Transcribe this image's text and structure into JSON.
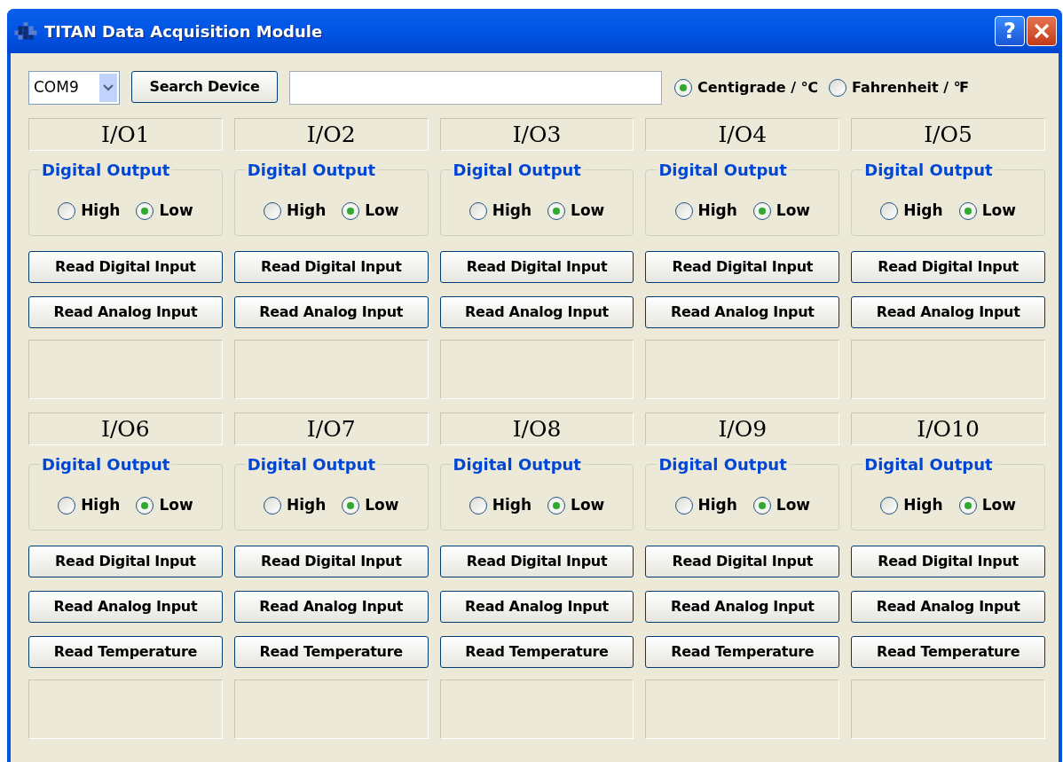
{
  "window": {
    "title": "TITAN Data Acquisition Module",
    "help_button": "?"
  },
  "toolbar": {
    "port": "COM9",
    "search_button": "Search Device",
    "units": [
      {
        "label": "Centigrade / ℃",
        "selected": true
      },
      {
        "label": "Fahrenheit / ℉",
        "selected": false
      }
    ]
  },
  "sections": [
    {
      "channels": [
        {
          "name": "I/O1",
          "group_title": "Digital Output",
          "options": [
            {
              "label": "High",
              "selected": false
            },
            {
              "label": "Low",
              "selected": true
            }
          ],
          "buttons": [
            "Read Digital Input",
            "Read Analog Input"
          ]
        },
        {
          "name": "I/O2",
          "group_title": "Digital Output",
          "options": [
            {
              "label": "High",
              "selected": false
            },
            {
              "label": "Low",
              "selected": true
            }
          ],
          "buttons": [
            "Read Digital Input",
            "Read Analog Input"
          ]
        },
        {
          "name": "I/O3",
          "group_title": "Digital Output",
          "options": [
            {
              "label": "High",
              "selected": false
            },
            {
              "label": "Low",
              "selected": true
            }
          ],
          "buttons": [
            "Read Digital Input",
            "Read Analog Input"
          ]
        },
        {
          "name": "I/O4",
          "group_title": "Digital Output",
          "options": [
            {
              "label": "High",
              "selected": false
            },
            {
              "label": "Low",
              "selected": true
            }
          ],
          "buttons": [
            "Read Digital Input",
            "Read Analog Input"
          ]
        },
        {
          "name": "I/O5",
          "group_title": "Digital Output",
          "options": [
            {
              "label": "High",
              "selected": false
            },
            {
              "label": "Low",
              "selected": true
            }
          ],
          "buttons": [
            "Read Digital Input",
            "Read Analog Input"
          ]
        }
      ]
    },
    {
      "channels": [
        {
          "name": "I/O6",
          "group_title": "Digital Output",
          "options": [
            {
              "label": "High",
              "selected": false
            },
            {
              "label": "Low",
              "selected": true
            }
          ],
          "buttons": [
            "Read Digital Input",
            "Read Analog Input",
            "Read Temperature"
          ]
        },
        {
          "name": "I/O7",
          "group_title": "Digital Output",
          "options": [
            {
              "label": "High",
              "selected": false
            },
            {
              "label": "Low",
              "selected": true
            }
          ],
          "buttons": [
            "Read Digital Input",
            "Read Analog Input",
            "Read Temperature"
          ]
        },
        {
          "name": "I/O8",
          "group_title": "Digital Output",
          "options": [
            {
              "label": "High",
              "selected": false
            },
            {
              "label": "Low",
              "selected": true
            }
          ],
          "buttons": [
            "Read Digital Input",
            "Read Analog Input",
            "Read Temperature"
          ]
        },
        {
          "name": "I/O9",
          "group_title": "Digital Output",
          "options": [
            {
              "label": "High",
              "selected": false
            },
            {
              "label": "Low",
              "selected": true
            }
          ],
          "buttons": [
            "Read Digital Input",
            "Read Analog Input",
            "Read Temperature"
          ]
        },
        {
          "name": "I/O10",
          "group_title": "Digital Output",
          "options": [
            {
              "label": "High",
              "selected": false
            },
            {
              "label": "Low",
              "selected": true
            }
          ],
          "buttons": [
            "Read Digital Input",
            "Read Analog Input",
            "Read Temperature"
          ]
        }
      ]
    }
  ]
}
